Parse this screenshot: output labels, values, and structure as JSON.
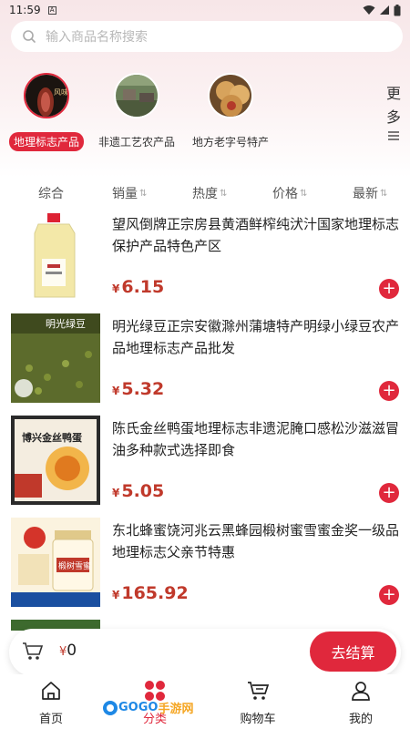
{
  "status": {
    "time": "11:59",
    "sim_label": "A"
  },
  "search": {
    "placeholder": "输入商品名称搜索"
  },
  "categories": [
    {
      "label": "地理标志产品",
      "active": true,
      "overlay_text": "风味腊"
    },
    {
      "label": "非遗工艺农产品",
      "active": false
    },
    {
      "label": "地方老字号特产",
      "active": false
    }
  ],
  "more": {
    "chars": [
      "更",
      "多"
    ]
  },
  "sort": [
    {
      "label": "综合",
      "arrows": ""
    },
    {
      "label": "销量",
      "arrows": "⇅"
    },
    {
      "label": "热度",
      "arrows": "⇅"
    },
    {
      "label": "价格",
      "arrows": "⇅"
    },
    {
      "label": "最新",
      "arrows": "⇅"
    }
  ],
  "products": [
    {
      "title": "望风倒牌正宗房县黄酒鲜榨纯汱汁国家地理标志保护产品特色产区",
      "currency": "¥",
      "price": "6.15",
      "thumb_text": ""
    },
    {
      "title": "明光绿豆正宗安徽滁州蒲塘特产明绿小绿豆农产品地理标志产品批发",
      "currency": "¥",
      "price": "5.32",
      "thumb_text": "明光绿豆"
    },
    {
      "title": "陈氏金丝鸭蛋地理标志非遗泥腌口感松沙滋滋冒油多种款式选择即食",
      "currency": "¥",
      "price": "5.05",
      "thumb_text": "博兴金丝鸭蛋"
    },
    {
      "title": "东北蜂蜜饶河兆云黑蜂园椴树蜜雪蜜金奖一级品地理标志父亲节特惠",
      "currency": "¥",
      "price": "165.92",
      "thumb_text": "椴树雪蜜"
    }
  ],
  "cart": {
    "currency": "¥",
    "total": "0",
    "checkout_label": "去结算"
  },
  "tabs": [
    {
      "label": "首页",
      "active": false
    },
    {
      "label": "分类",
      "active": true
    },
    {
      "label": "购物车",
      "active": false
    },
    {
      "label": "我的",
      "active": false
    }
  ],
  "watermark": {
    "text_a": "GOGO",
    "text_b": "手游网"
  },
  "colors": {
    "accent": "#e0283c",
    "price": "#c0392b"
  }
}
